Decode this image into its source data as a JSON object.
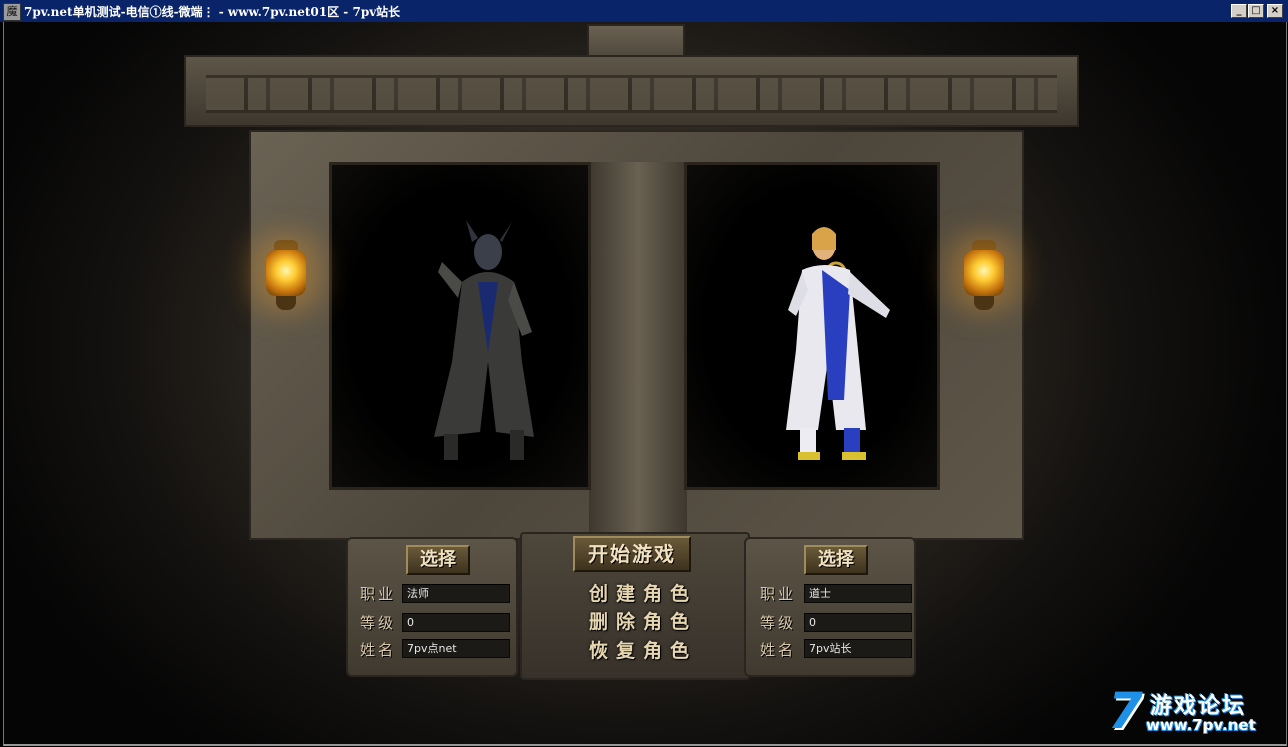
{
  "window": {
    "icon_glyph": "魔",
    "title": "7pv.net单机测试-电信①线-微端⋮ - www.7pv.net01区 - 7pv站长",
    "minimize": "_",
    "maximize": "□",
    "close": "×"
  },
  "left_slot": {
    "select_label": "选择",
    "job_label": "职业",
    "job_value": "法师",
    "level_label": "等级",
    "level_value": "0",
    "name_label": "姓名",
    "name_value": "7pv点net"
  },
  "right_slot": {
    "select_label": "选择",
    "job_label": "职业",
    "job_value": "道士",
    "level_label": "等级",
    "level_value": "0",
    "name_label": "姓名",
    "name_value": "7pv站长"
  },
  "menu": {
    "start_game": "开始游戏",
    "create_role": "创建角色",
    "delete_role": "删除角色",
    "restore_role": "恢复角色"
  },
  "watermark": {
    "digit": "7",
    "name": "游戏论坛",
    "url": "www.7pv.net",
    "color": "#1e90e8"
  },
  "icons": [
    "app-icon",
    "lantern-icon",
    "mage-character-icon",
    "taoist-character-icon"
  ]
}
